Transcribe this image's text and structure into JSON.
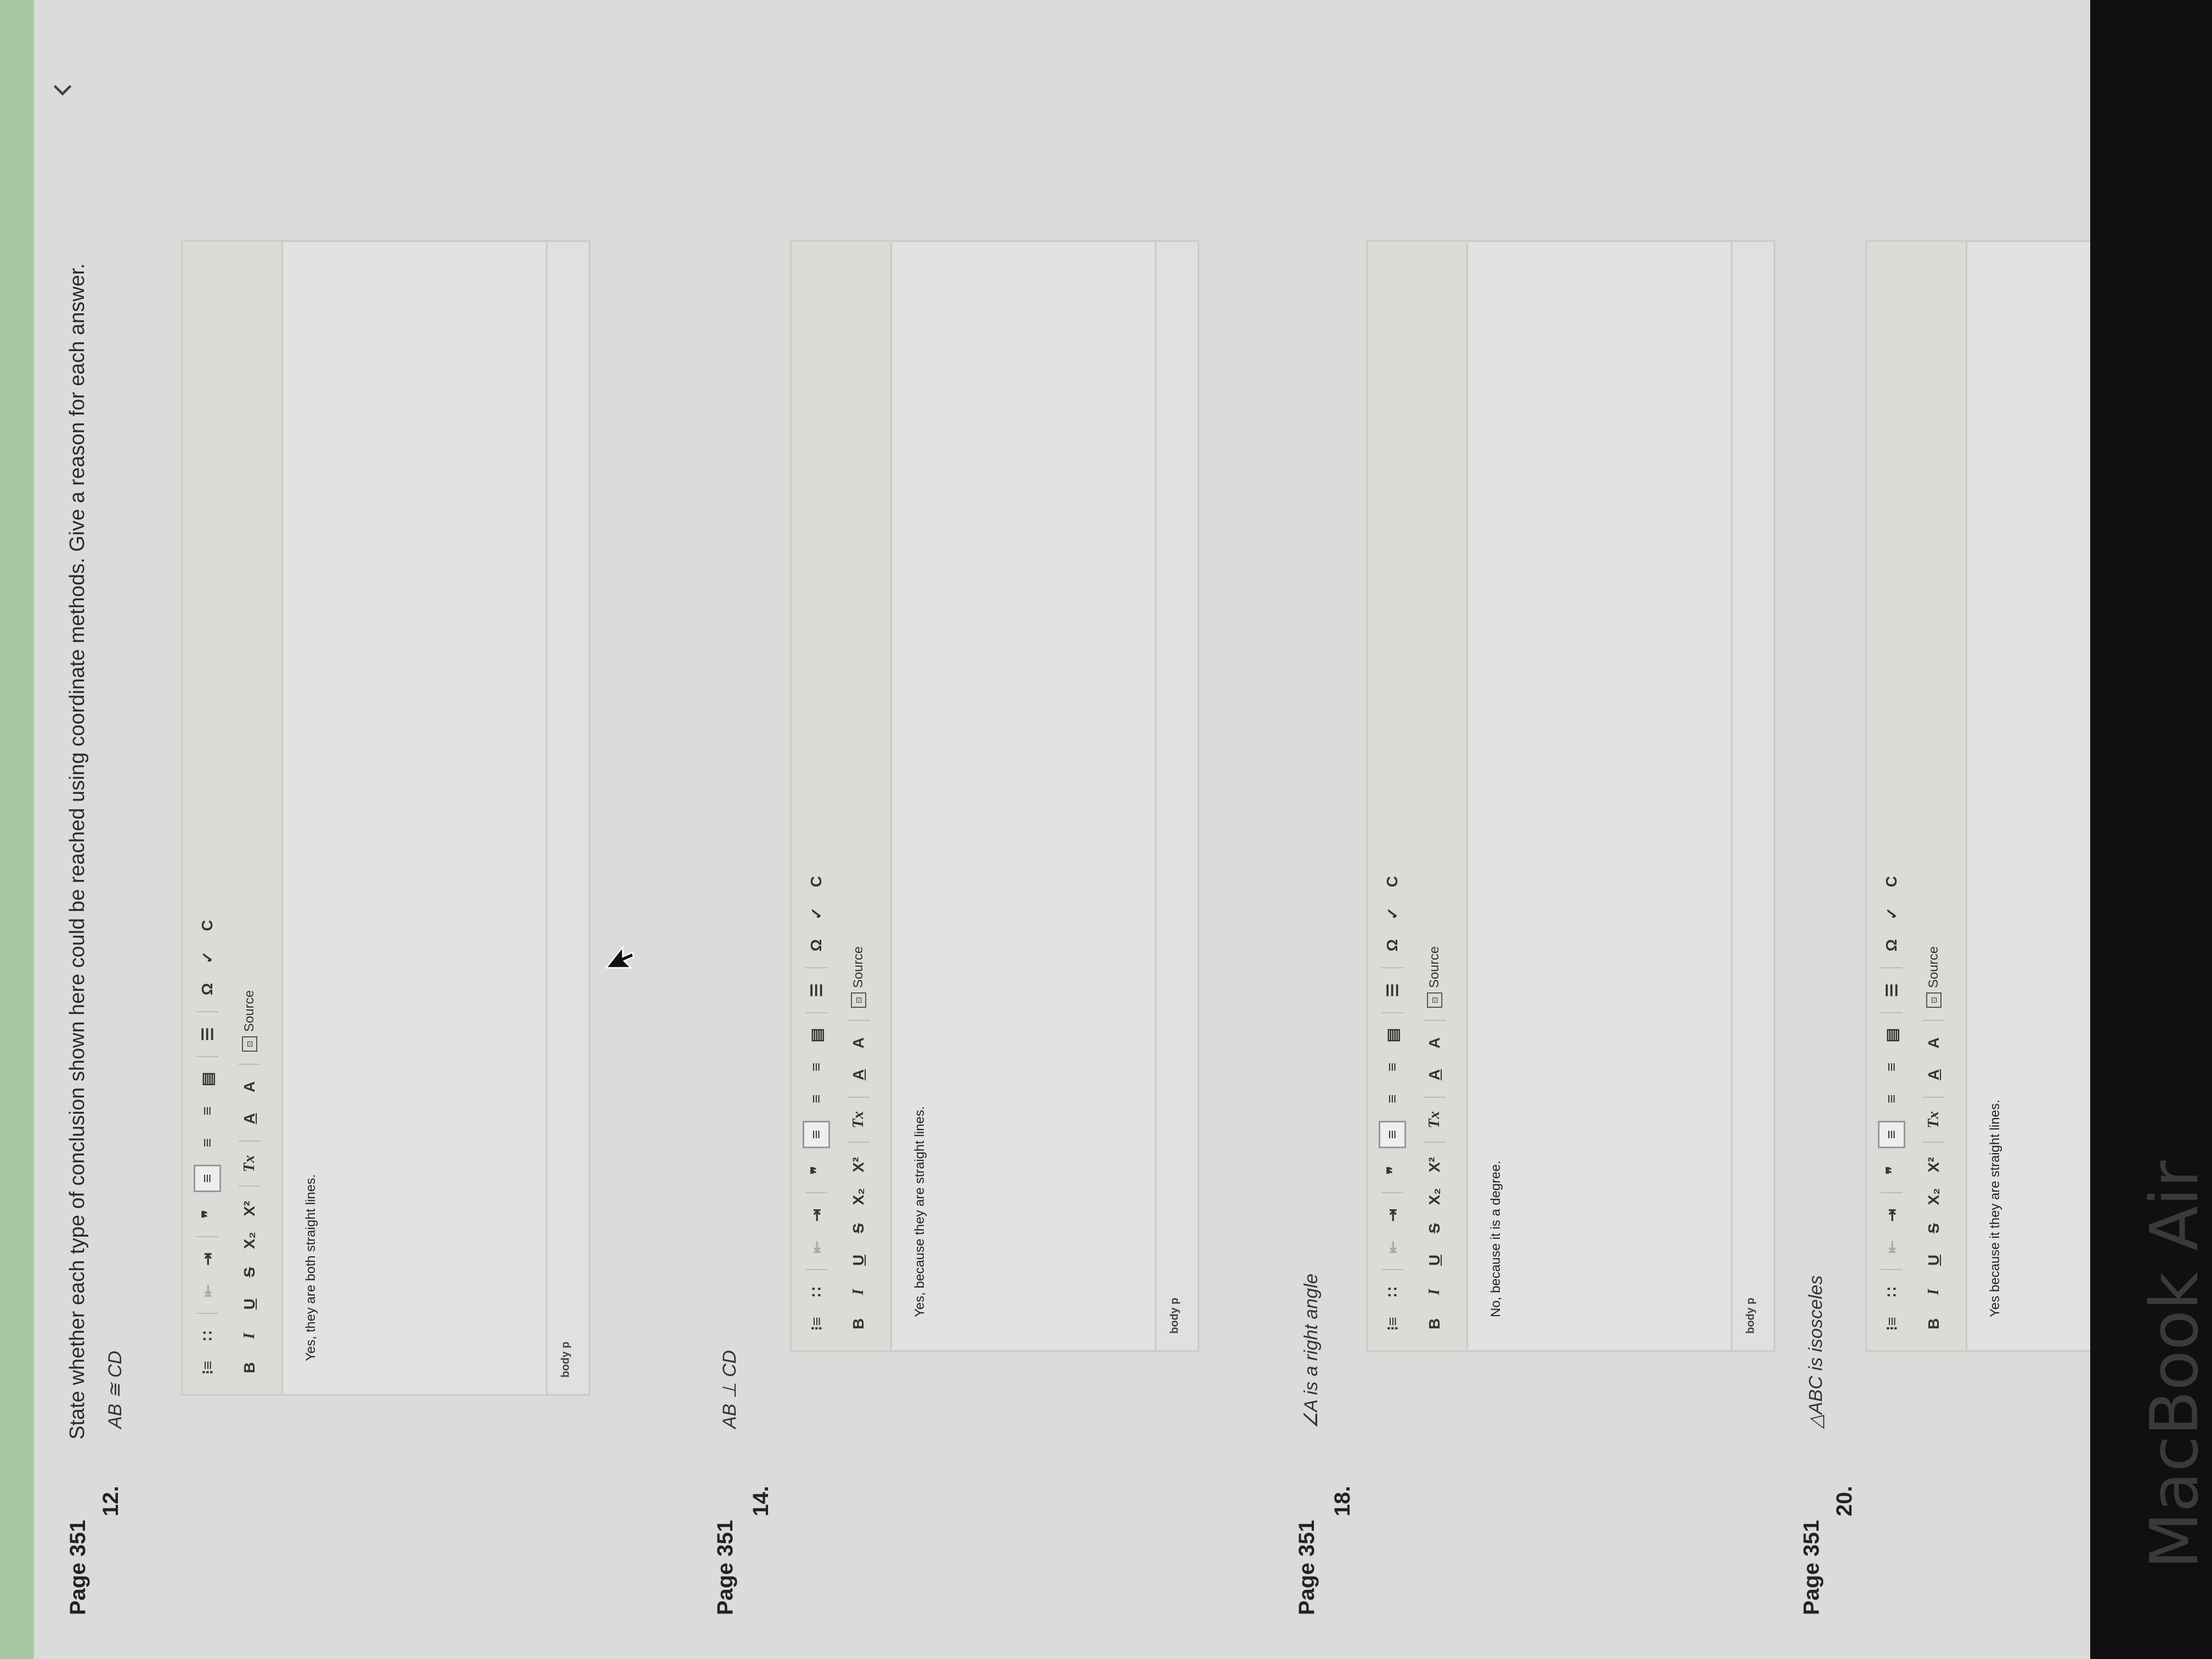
{
  "instructions": "State whether each type of conclusion shown here could be reached using coordinate methods. Give a reason for each answer.",
  "toolbar": {
    "row1": [
      "list-ordered-icon",
      "list-bullet-icon",
      "outdent-icon",
      "indent-icon",
      "blockquote-icon",
      "align-left-icon",
      "align-center-icon",
      "align-right-icon",
      "align-justify-icon",
      "line-icon",
      "omega-icon",
      "checkmark-icon",
      "copyright-icon"
    ],
    "bold": "B",
    "italic": "I",
    "underline": "U",
    "strike": "S",
    "subscript": "X₂",
    "superscript": "X²",
    "clear_format": "Tx",
    "text_color": "A",
    "bg_color": "A",
    "special_char": "Ω",
    "check": "✓",
    "c": "C",
    "source": "Source"
  },
  "statusbar_path": "body p",
  "questions": [
    {
      "page": "Page 351",
      "number": "12.",
      "statement": "AB ≅ CD",
      "answer": "Yes, they are both straight lines."
    },
    {
      "page": "Page 351",
      "number": "14.",
      "statement": "AB ⊥ CD",
      "answer": "Yes, because they are straight lines."
    },
    {
      "page": "Page 351",
      "number": "18.",
      "statement": "∠A is a right angle",
      "answer": "No, because it is a degree."
    },
    {
      "page": "Page 351",
      "number": "20.",
      "statement": "△ABC is isosceles",
      "answer": "Yes because it they are straight lines."
    }
  ],
  "laptop_label": "MacBook Air",
  "colors": {
    "screen_bg": "#d9dcd9",
    "green_strip": "#a8c8a4",
    "frame": "#101012"
  }
}
